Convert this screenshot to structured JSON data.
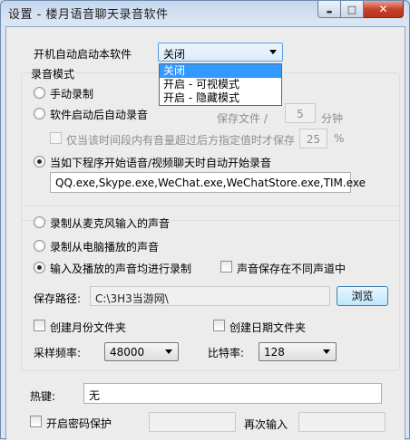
{
  "window": {
    "title": "设置 - 楼月语音聊天录音软件",
    "close_glyph": "✕",
    "min_glyph": "▬",
    "max_glyph": "□"
  },
  "startup": {
    "label": "开机自动启动本软件",
    "selected": "关闭",
    "options": [
      "关闭",
      "开启 - 可视模式",
      "开启 - 隐藏模式"
    ]
  },
  "record_mode": {
    "title": "录音模式",
    "manual": "手动录制",
    "auto_on_start": "软件启动后自动录音",
    "save_file_prefix": "保存文件 /",
    "save_minutes": "5",
    "minutes_unit": "分钟",
    "volume_only": "仅当该时间段内有音量超过后方指定值时才保存",
    "volume_value": "25",
    "percent": "%",
    "auto_on_chat": "当如下程序开始语音/视频聊天时自动开始录音",
    "programs": "QQ.exe,Skype.exe,WeChat.exe,WeChatStore.exe,TIM.exe",
    "selected": "auto_on_chat"
  },
  "source": {
    "mic": "录制从麦克风输入的声音",
    "speaker": "录制从电脑播放的声音",
    "both": "输入及播放的声音均进行录制",
    "diff_channel": "声音保存在不同声道中",
    "selected": "both",
    "save_path_label": "保存路径:",
    "save_path": "C:\\3H3当游网\\",
    "browse": "浏览",
    "monthly_folder": "创建月份文件夹",
    "daily_folder": "创建日期文件夹",
    "sample_rate_label": "采样频率:",
    "sample_rate": "48000",
    "bitrate_label": "比特率:",
    "bitrate": "128"
  },
  "hotkey": {
    "label": "热键:",
    "value": "无"
  },
  "password": {
    "enable": "开启密码保护",
    "confirm_label": "再次输入"
  }
}
